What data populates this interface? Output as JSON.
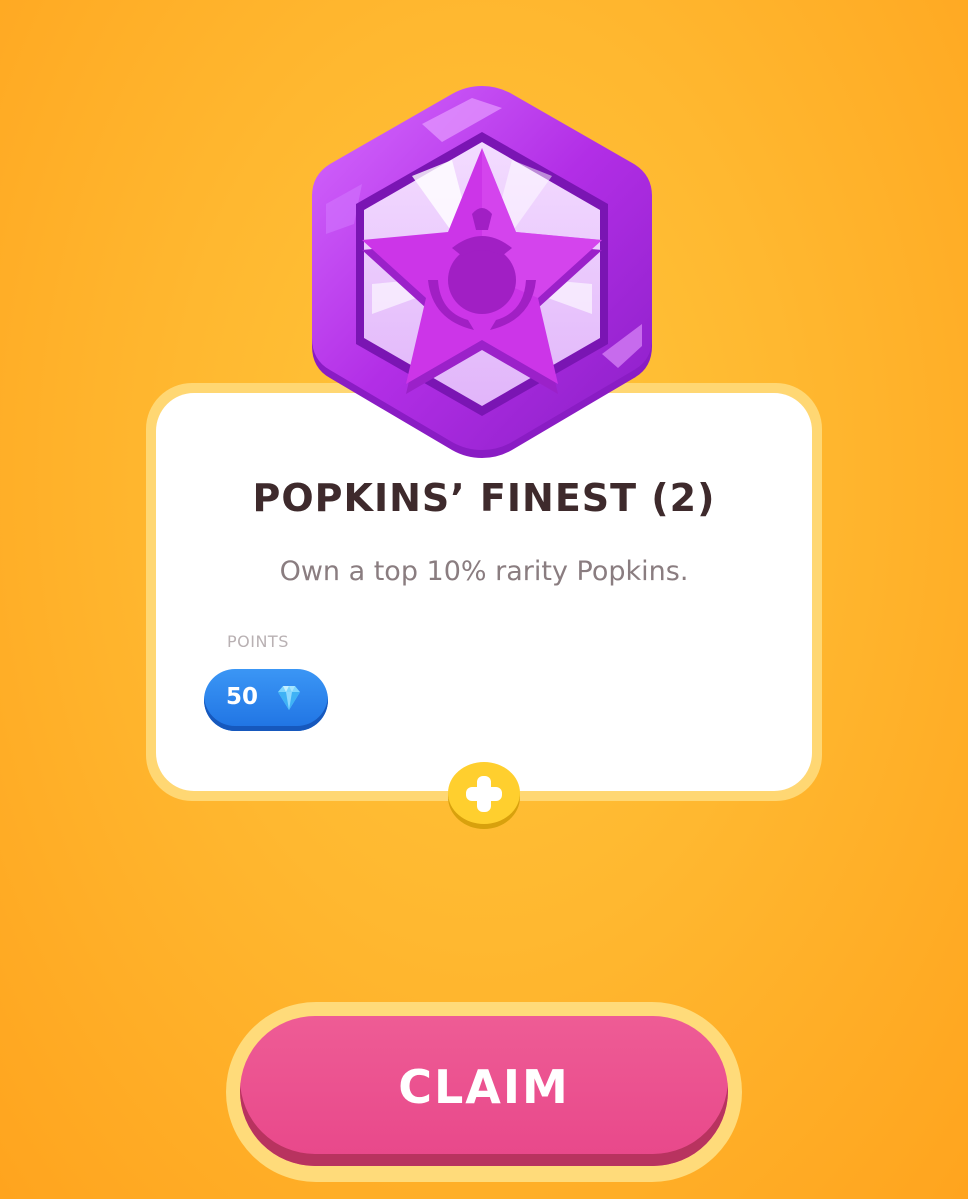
{
  "achievement": {
    "title": "POPKINS’ FINEST (2)",
    "description": "Own a top 10% rarity Popkins.",
    "badge_icon": "purple-star-crest-badge"
  },
  "reward": {
    "label": "POINTS",
    "value": "50",
    "currency_icon": "blue-diamond-icon"
  },
  "expand_icon": "yellow-plus-icon",
  "claim_button": {
    "label": "CLAIM"
  },
  "colors": {
    "background": "#ffb830",
    "card": "#ffffff",
    "title_text": "#3e2a2c",
    "points_pill": "#2a85ee",
    "claim_button": "#e94c8c",
    "badge": "#b22ee6"
  }
}
